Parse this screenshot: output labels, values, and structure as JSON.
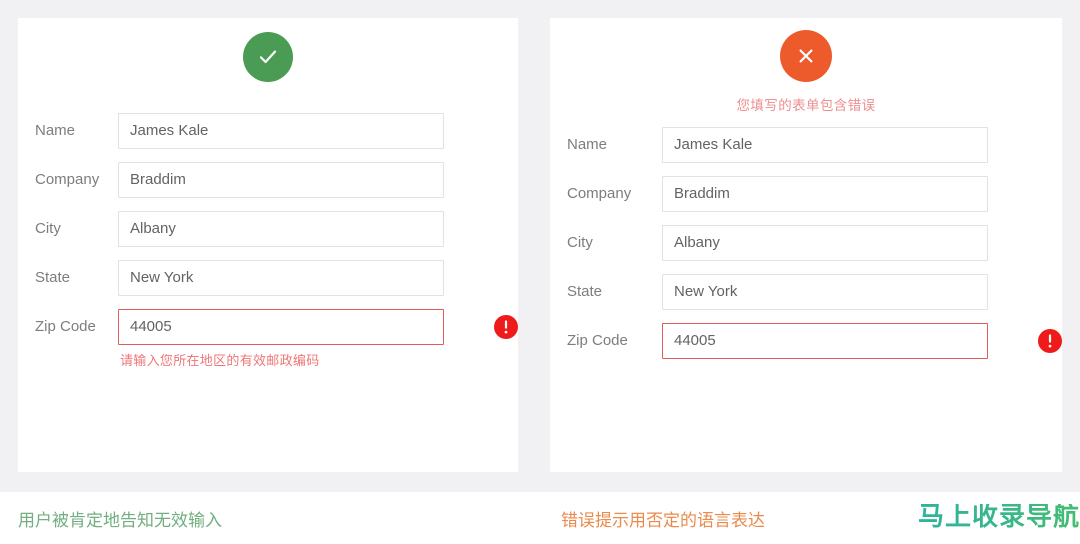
{
  "colors": {
    "page_background": "#ffffff",
    "stage_background": "#f1f1f3",
    "card_background": "#ffffff",
    "success_green": "#4a9c55",
    "error_orange": "#ed5b2d",
    "error_red": "#ef1b1b",
    "invalid_border": "#e15b5b",
    "error_text": "#ef7676",
    "label_gray": "#7d7d80",
    "value_gray": "#636366",
    "field_border": "#e2e2e2",
    "caption_green": "#72ae7f",
    "caption_orange": "#ea8a4c",
    "watermark_teal": "#2fb49a"
  },
  "panels": {
    "good": {
      "status_icon": "check-circle-icon",
      "status_icon_glyph": "check",
      "notice": "",
      "notice_visible": false,
      "fields": [
        {
          "label": "Name",
          "value": "James Kale",
          "invalid": false,
          "error": ""
        },
        {
          "label": "Company",
          "value": "Braddim",
          "invalid": false,
          "error": ""
        },
        {
          "label": "City",
          "value": "Albany",
          "invalid": false,
          "error": ""
        },
        {
          "label": "State",
          "value": "New York",
          "invalid": false,
          "error": ""
        },
        {
          "label": "Zip Code",
          "value": "44005",
          "invalid": true,
          "error": "请输入您所在地区的有效邮政编码"
        }
      ],
      "caption": "用户被肯定地告知无效输入"
    },
    "bad": {
      "status_icon": "x-circle-icon",
      "status_icon_glyph": "cross",
      "notice": "您填写的表单包含错误",
      "notice_visible": true,
      "fields": [
        {
          "label": "Name",
          "value": "James Kale",
          "invalid": false,
          "error": ""
        },
        {
          "label": "Company",
          "value": "Braddim",
          "invalid": false,
          "error": ""
        },
        {
          "label": "City",
          "value": "Albany",
          "invalid": false,
          "error": ""
        },
        {
          "label": "State",
          "value": "New York",
          "invalid": false,
          "error": ""
        },
        {
          "label": "Zip Code",
          "value": "44005",
          "invalid": true,
          "error": ""
        }
      ],
      "caption": "错误提示用否定的语言表达"
    }
  },
  "watermark": {
    "text": "马上收录导航"
  }
}
